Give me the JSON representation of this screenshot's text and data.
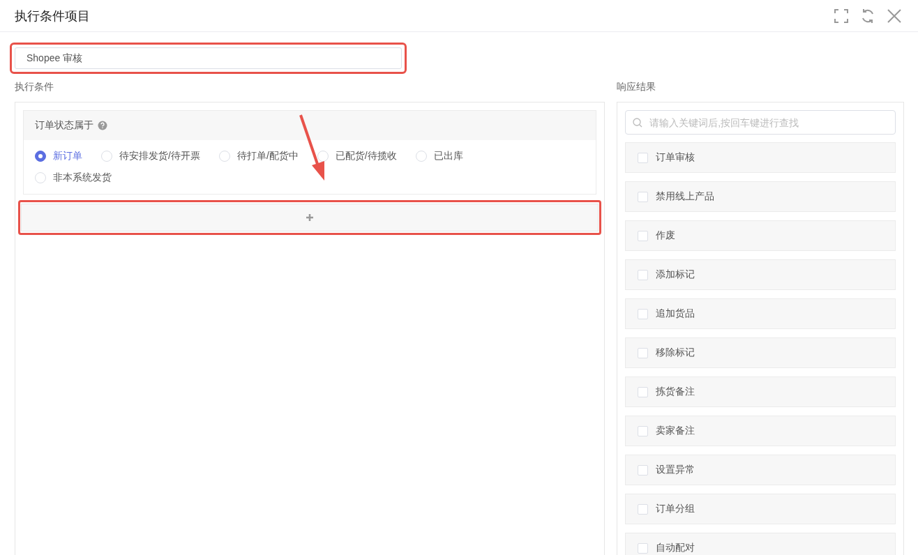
{
  "window": {
    "title": "执行条件项目"
  },
  "name_field": {
    "value": "Shopee 审核"
  },
  "conditions": {
    "label": "执行条件",
    "group": {
      "title": "订单状态属于",
      "options": [
        {
          "label": "新订单",
          "selected": true
        },
        {
          "label": "待安排发货/待开票",
          "selected": false
        },
        {
          "label": "待打单/配货中",
          "selected": false
        },
        {
          "label": "已配货/待揽收",
          "selected": false
        },
        {
          "label": "已出库",
          "selected": false
        },
        {
          "label": "非本系统发货",
          "selected": false
        }
      ]
    }
  },
  "results": {
    "label": "响应结果",
    "search": {
      "placeholder": "请输入关键词后,按回车键进行查找"
    },
    "items": [
      {
        "label": "订单审核",
        "checked": false
      },
      {
        "label": "禁用线上产品",
        "checked": false
      },
      {
        "label": "作废",
        "checked": false
      },
      {
        "label": "添加标记",
        "checked": false
      },
      {
        "label": "追加货品",
        "checked": false
      },
      {
        "label": "移除标记",
        "checked": false
      },
      {
        "label": "拣货备注",
        "checked": false
      },
      {
        "label": "卖家备注",
        "checked": false
      },
      {
        "label": "设置异常",
        "checked": false
      },
      {
        "label": "订单分组",
        "checked": false
      },
      {
        "label": "自动配对",
        "checked": false
      }
    ]
  }
}
